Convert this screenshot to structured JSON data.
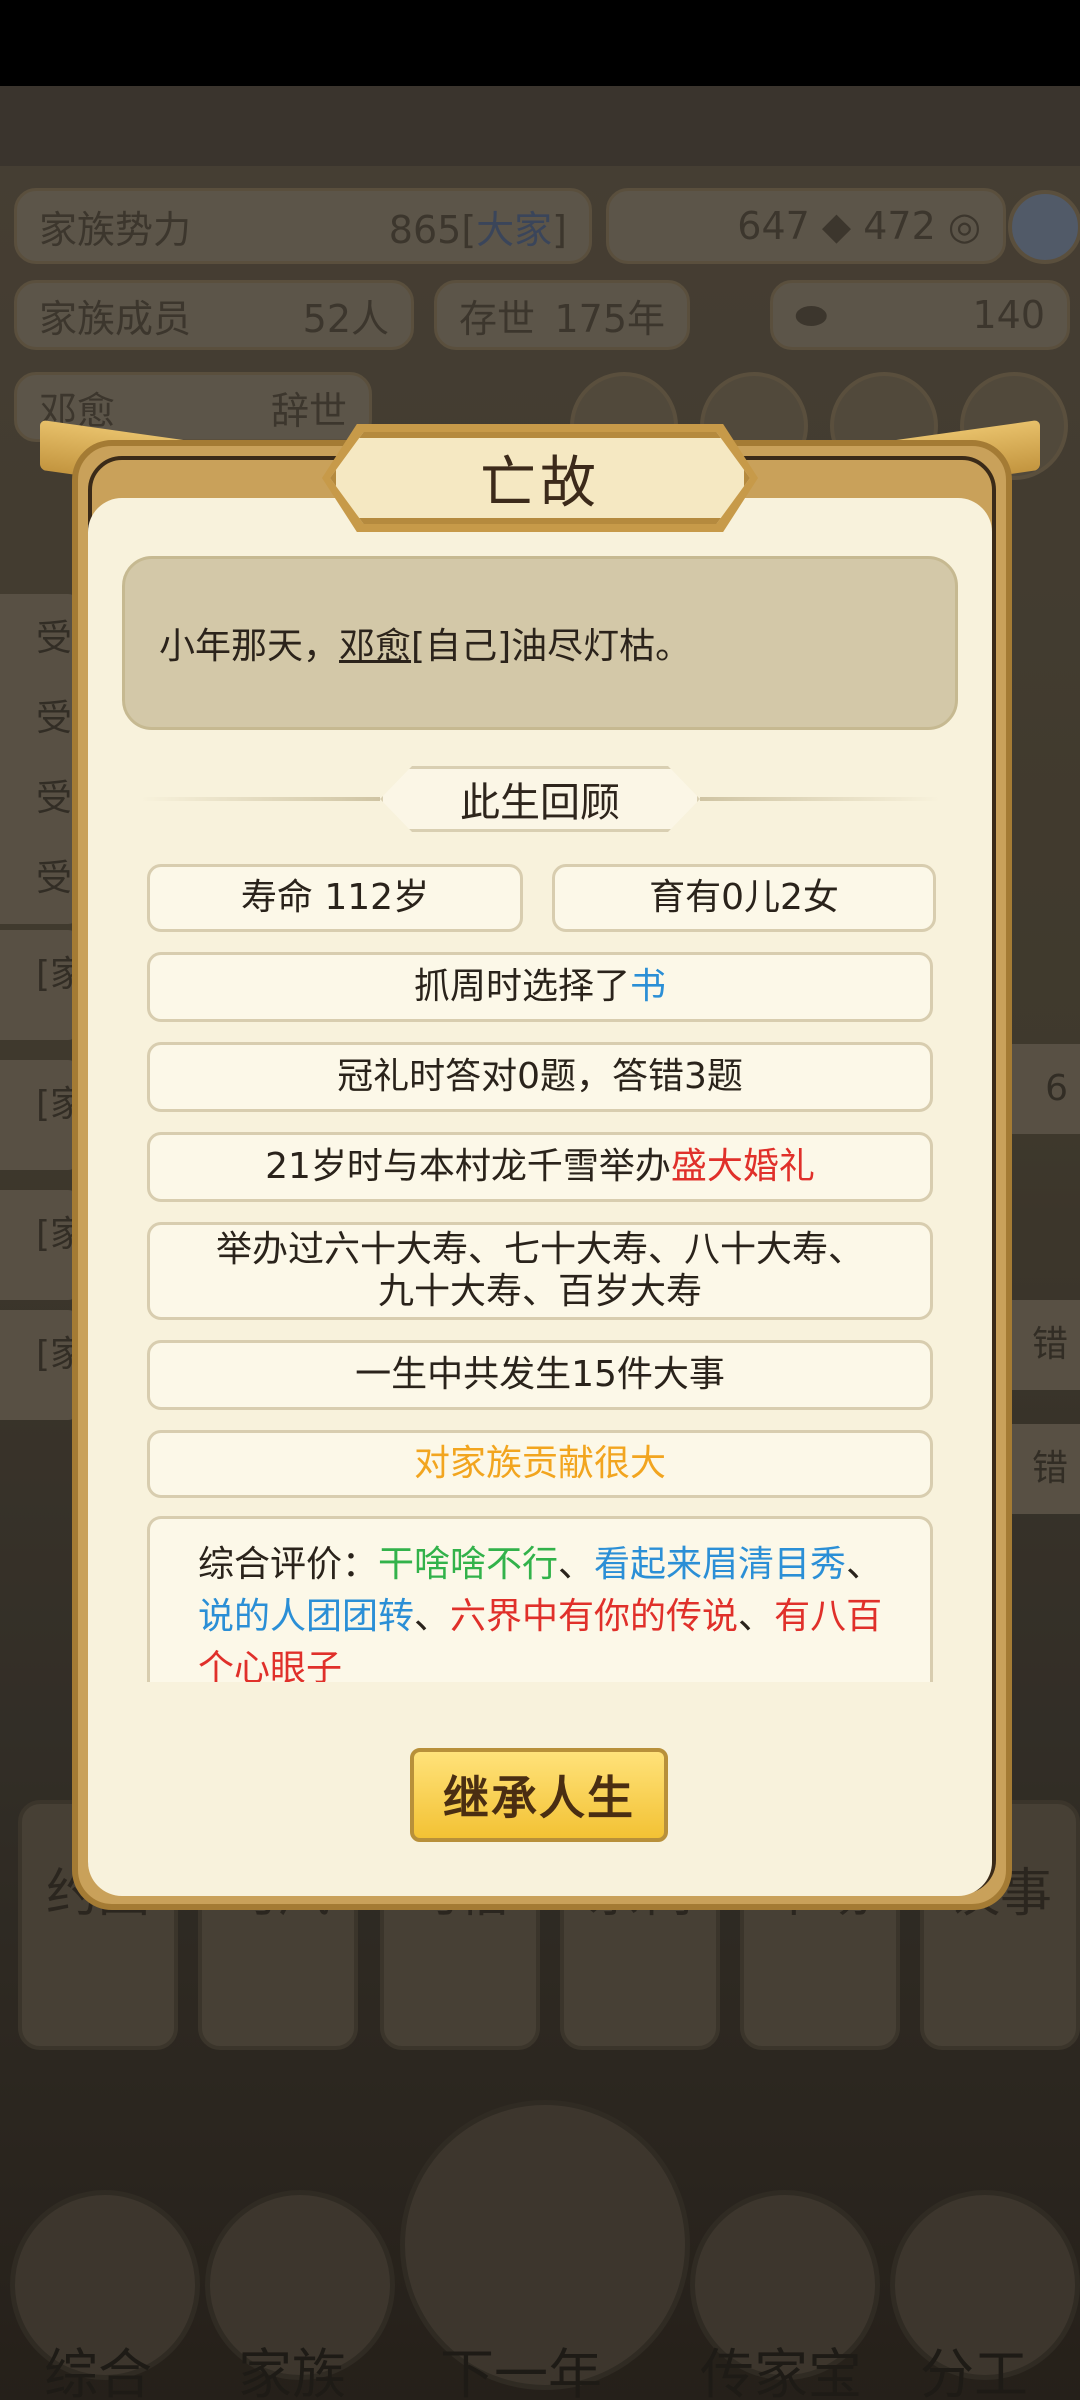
{
  "hud": {
    "clan_power_label": "家族势力",
    "clan_power_value": "865[",
    "clan_power_rank": "大家",
    "clan_power_close": "]",
    "currency1": "647",
    "currency2": "472",
    "members_label": "家族成员",
    "members_value": "52人",
    "exist_label": "存世",
    "exist_value": "175年",
    "gold_value": "140",
    "person_name": "邓愈",
    "person_status": "辞世"
  },
  "background_side": {
    "left_items": [
      "受",
      "受",
      "受",
      "受",
      "[家",
      "[家",
      "[家",
      "[家"
    ],
    "right_items": [
      "6",
      "错",
      "错"
    ]
  },
  "bottom_cards": [
    "约园",
    "习风",
    "习俗",
    "宗祠",
    "市场",
    "议事"
  ],
  "bottom_nav": [
    "综合",
    "家族",
    "下一年",
    "传家宝",
    "分工"
  ],
  "modal": {
    "title": "亡故",
    "death_prefix": "小年那天，",
    "death_name": "邓愈",
    "death_suffix": "[自己]油尽灯枯。",
    "review_title": "此生回顾",
    "lifespan": "寿命 112岁",
    "children": "育有0儿2女",
    "zhuazhou_prefix": "抓周时选择了",
    "zhuazhou_item": "书",
    "guanli": "冠礼时答对0题，答错3题",
    "wedding_prefix": "21岁时与本村龙千雪举办",
    "wedding_highlight": "盛大婚礼",
    "birthdays_line1": "举办过六十大寿、七十大寿、八十大寿、",
    "birthdays_line2": "九十大寿、百岁大寿",
    "events": "一生中共发生15件大事",
    "contribution": "对家族贡献很大",
    "eval_label": "综合评价：",
    "eval_t1": "干啥啥不行",
    "sep": "、",
    "eval_t2": "看起来眉清目秀",
    "eval_t3": "说的人团团转",
    "eval_t4": "六界中有你的传说",
    "eval_t5": "有八百个心眼子",
    "inherit_button": "继承人生"
  },
  "colors": {
    "blue": "#2b8fd6",
    "red": "#e0302a",
    "orange": "#f2a51f",
    "green": "#32b24a",
    "modal_bg": "#f8f2dc",
    "frame_gold": "#c9a15a"
  }
}
